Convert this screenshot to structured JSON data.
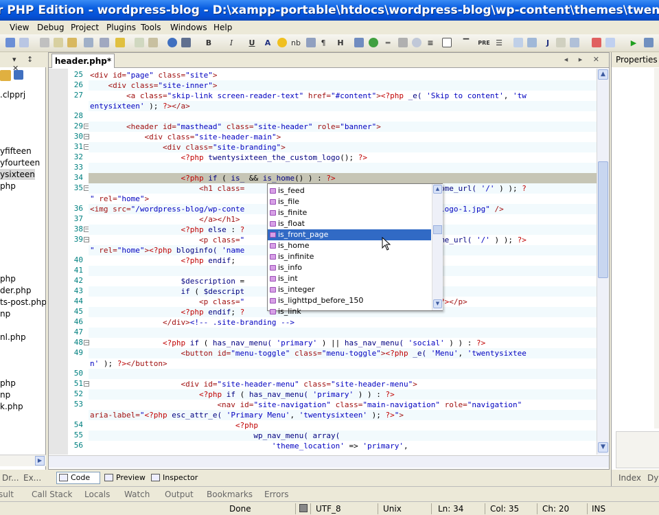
{
  "window": {
    "title": "r PHP Edition - wordpress-blog - D:\\xampp-portable\\htdocs\\wordpress-blog\\wp-content\\themes\\twentysixteen\\hea"
  },
  "menu": [
    "View",
    "Debug",
    "Project",
    "Plugins",
    "Tools",
    "Windows",
    "Help"
  ],
  "toolbar": {
    "icons": [
      "undo-icon",
      "redo-icon",
      "cut-icon",
      "copy-icon",
      "paste-icon",
      "find-icon",
      "replace-icon",
      "bold-icon",
      "italic-icon",
      "underline-icon",
      "anchor-icon",
      "image-icon",
      "table-icon",
      "run-icon"
    ],
    "labels": [
      "B",
      "I",
      "U",
      "A",
      "nb",
      "H",
      "PRE",
      "J"
    ]
  },
  "left_panel": {
    "head_ctrls": "▾ ↕ ✕",
    "files": [
      ".clpprj",
      "yfifteen",
      "yfourteen",
      "ysixteen",
      "php",
      "php",
      "der.php",
      "ts-post.php",
      "np",
      "nl.php",
      "php",
      "np",
      "k.php"
    ],
    "tabs": [
      "Dr...",
      "Ex..."
    ]
  },
  "editor": {
    "tab_label": "header.php*",
    "tab_controls": "◂ ▸ ✕",
    "lines": [
      {
        "no": "25",
        "html": "<span class='tag'>&lt;div</span> <span class='attr'>id=</span><span class='str'>\"page\"</span> <span class='attr'>class=</span><span class='str'>\"site\"</span><span class='tag'>&gt;</span>"
      },
      {
        "no": "26",
        "html": "    <span class='tag'>&lt;div</span> <span class='attr'>class=</span><span class='str'>\"site-inner\"</span><span class='tag'>&gt;</span>"
      },
      {
        "no": "27",
        "html": "        <span class='tag'>&lt;a</span> <span class='attr'>class=</span><span class='str'>\"skip-link screen-reader-text\"</span> <span class='attr'>href=</span><span class='str'>\"#content\"</span><span class='tag'>&gt;</span><span class='php'>&lt;?php</span> <span class='fn'>_e(</span> <span class='str'>'Skip to content'</span>, <span class='str'>'tw</span>"
      },
      {
        "no": "",
        "html": "<span class='str'>entysixteen'</span> ); <span class='php'>?&gt;</span><span class='tag'>&lt;/a&gt;</span>"
      },
      {
        "no": "28",
        "html": ""
      },
      {
        "no": "29",
        "html": "        <span class='tag'>&lt;header</span> <span class='attr'>id=</span><span class='str'>\"masthead\"</span> <span class='attr'>class=</span><span class='str'>\"site-header\"</span> <span class='attr'>role=</span><span class='str'>\"banner\"</span><span class='tag'>&gt;</span>"
      },
      {
        "no": "30",
        "html": "            <span class='tag'>&lt;div</span> <span class='attr'>class=</span><span class='str'>\"site-header-main\"</span><span class='tag'>&gt;</span>"
      },
      {
        "no": "31",
        "html": "                <span class='tag'>&lt;div</span> <span class='attr'>class=</span><span class='str'>\"site-branding\"</span><span class='tag'>&gt;</span>"
      },
      {
        "no": "32",
        "html": "                    <span class='php'>&lt;?php</span> <span class='fn'>twentysixteen_the_custom_logo</span>(); <span class='php'>?&gt;</span>"
      },
      {
        "no": "33",
        "html": ""
      },
      {
        "no": "34",
        "html": "                    <span class='php'>&lt;?php</span> <span class='fn'>if</span> ( <span class='fn'>is_</span> &amp;&amp; <span class='fn'>is_home</span>() ) : <span class='php'>?&gt;</span>"
      },
      {
        "no": "35",
        "html": "                        <span class='tag'>&lt;h1</span> <span class='attr'>class=</span>                                   <span class='fn'>c_url(</span> <span class='fn'>home_url(</span> <span class='str'>'/'</span> ) ); <span class='php'>?</span>"
      },
      {
        "no": "",
        "html": "<span class='str'>\"</span> <span class='attr'>rel=</span><span class='str'>\"home\"</span><span class='tag'>&gt;</span>"
      },
      {
        "no": "36",
        "html": "<span class='tag'>&lt;img</span> <span class='attr'>src=</span><span class='str'>\"/wordpress-blog/wp-conte</span>                                   <span class='str'>lobster-logo-1.jpg\"</span> <span class='tag'>/&gt;</span>"
      },
      {
        "no": "37",
        "html": "                        <span class='tag'>&lt;/a&gt;&lt;/h1&gt;</span>"
      },
      {
        "no": "38",
        "html": "                    <span class='php'>&lt;?php</span> <span class='fn'>else</span> : <span class='php'>?</span>"
      },
      {
        "no": "39",
        "html": "                        <span class='tag'>&lt;p</span> <span class='attr'>class=</span><span class='str'>\"</span>                                   <span class='fn'>_url(</span> <span class='fn'>home_url(</span> <span class='str'>'/'</span> ) ); <span class='php'>?&gt;</span>"
      },
      {
        "no": "",
        "html": "<span class='str'>\"</span> <span class='attr'>rel=</span><span class='str'>\"home\"</span><span class='tag'>&gt;</span><span class='php'>&lt;?php</span> <span class='fn'>bloginfo(</span> <span class='str'>'name</span>"
      },
      {
        "no": "40",
        "html": "                    <span class='php'>&lt;?php</span> <span class='fn'>endif</span>;"
      },
      {
        "no": "41",
        "html": ""
      },
      {
        "no": "42",
        "html": "                    <span class='fn'>$description</span> =                                   <span class='str'>lay'</span> );"
      },
      {
        "no": "43",
        "html": "                    <span class='fn'>if</span> ( <span class='fn'>$descript</span>                                    <span class='php'>&gt;</span>"
      },
      {
        "no": "44",
        "html": "                        <span class='tag'>&lt;p</span> <span class='attr'>class=</span><span class='str'>\"</span>                                   <span class='fn'>iption</span>; <span class='php'>?&gt;</span><span class='tag'>&lt;/p&gt;</span>"
      },
      {
        "no": "45",
        "html": "                    <span class='php'>&lt;?php</span> <span class='fn'>endif</span>; <span class='php'>?</span>"
      },
      {
        "no": "46",
        "html": "                <span class='tag'>&lt;/div&gt;</span><span class='str'>&lt;!-- .site-branding --&gt;</span>"
      },
      {
        "no": "47",
        "html": ""
      },
      {
        "no": "48",
        "html": "                <span class='php'>&lt;?php</span> <span class='fn'>if</span> ( <span class='fn'>has_nav_menu(</span> <span class='str'>'primary'</span> ) || <span class='fn'>has_nav_menu(</span> <span class='str'>'social'</span> ) ) : <span class='php'>?&gt;</span>"
      },
      {
        "no": "49",
        "html": "                    <span class='tag'>&lt;button</span> <span class='attr'>id=</span><span class='str'>\"menu-toggle\"</span> <span class='attr'>class=</span><span class='str'>\"menu-toggle\"</span><span class='tag'>&gt;</span><span class='php'>&lt;?php</span> <span class='fn'>_e(</span> <span class='str'>'Menu'</span>, <span class='str'>'twentysixtee</span>"
      },
      {
        "no": "",
        "html": "<span class='str'>n'</span> ); <span class='php'>?&gt;</span><span class='tag'>&lt;/button&gt;</span>"
      },
      {
        "no": "50",
        "html": ""
      },
      {
        "no": "51",
        "html": "                    <span class='tag'>&lt;div</span> <span class='attr'>id=</span><span class='str'>\"site-header-menu\"</span> <span class='attr'>class=</span><span class='str'>\"site-header-menu\"</span><span class='tag'>&gt;</span>"
      },
      {
        "no": "52",
        "html": "                        <span class='php'>&lt;?php</span> <span class='fn'>if</span> ( <span class='fn'>has_nav_menu(</span> <span class='str'>'primary'</span> ) ) : <span class='php'>?&gt;</span>"
      },
      {
        "no": "53",
        "html": "                            <span class='tag'>&lt;nav</span> <span class='attr'>id=</span><span class='str'>\"site-navigation\"</span> <span class='attr'>class=</span><span class='str'>\"main-navigation\"</span> <span class='attr'>role=</span><span class='str'>\"navigation\"</span>"
      },
      {
        "no": "",
        "html": "<span class='attr'>aria-label=</span><span class='str'>\"</span><span class='php'>&lt;?php</span> <span class='fn'>esc_attr_e(</span> <span class='str'>'Primary Menu'</span>, <span class='str'>'twentysixteen'</span> ); <span class='php'>?&gt;</span><span class='str'>\"</span><span class='tag'>&gt;</span>"
      },
      {
        "no": "54",
        "html": "                                <span class='php'>&lt;?php</span>"
      },
      {
        "no": "55",
        "html": "                                    <span class='fn'>wp_nav_menu(</span> <span class='fn'>array(</span>"
      },
      {
        "no": "56",
        "html": "                                        <span class='str'>'theme_location'</span> =&gt; <span class='str'>'primary'</span>,"
      }
    ]
  },
  "autocomplete": {
    "items": [
      "is_feed",
      "is_file",
      "is_finite",
      "is_float",
      "is_front_page",
      "is_home",
      "is_infinite",
      "is_info",
      "is_int",
      "is_integer",
      "is_lighttpd_before_150",
      "is_link"
    ],
    "selected": "is_front_page"
  },
  "view_tabs": [
    "Code",
    "Preview",
    "Inspector"
  ],
  "right_panel": {
    "title": "Properties",
    "tabs": [
      "Index",
      "Dyn"
    ]
  },
  "bottom_tabs": [
    "sult",
    "Call Stack",
    "Locals",
    "Watch",
    "Output",
    "Bookmarks",
    "Errors"
  ],
  "status": {
    "state": "Done",
    "encoding": "UTF_8",
    "eol": "Unix",
    "line": "Ln: 34",
    "col": "Col: 35",
    "ch": "Ch: 20",
    "mode": "INS"
  }
}
